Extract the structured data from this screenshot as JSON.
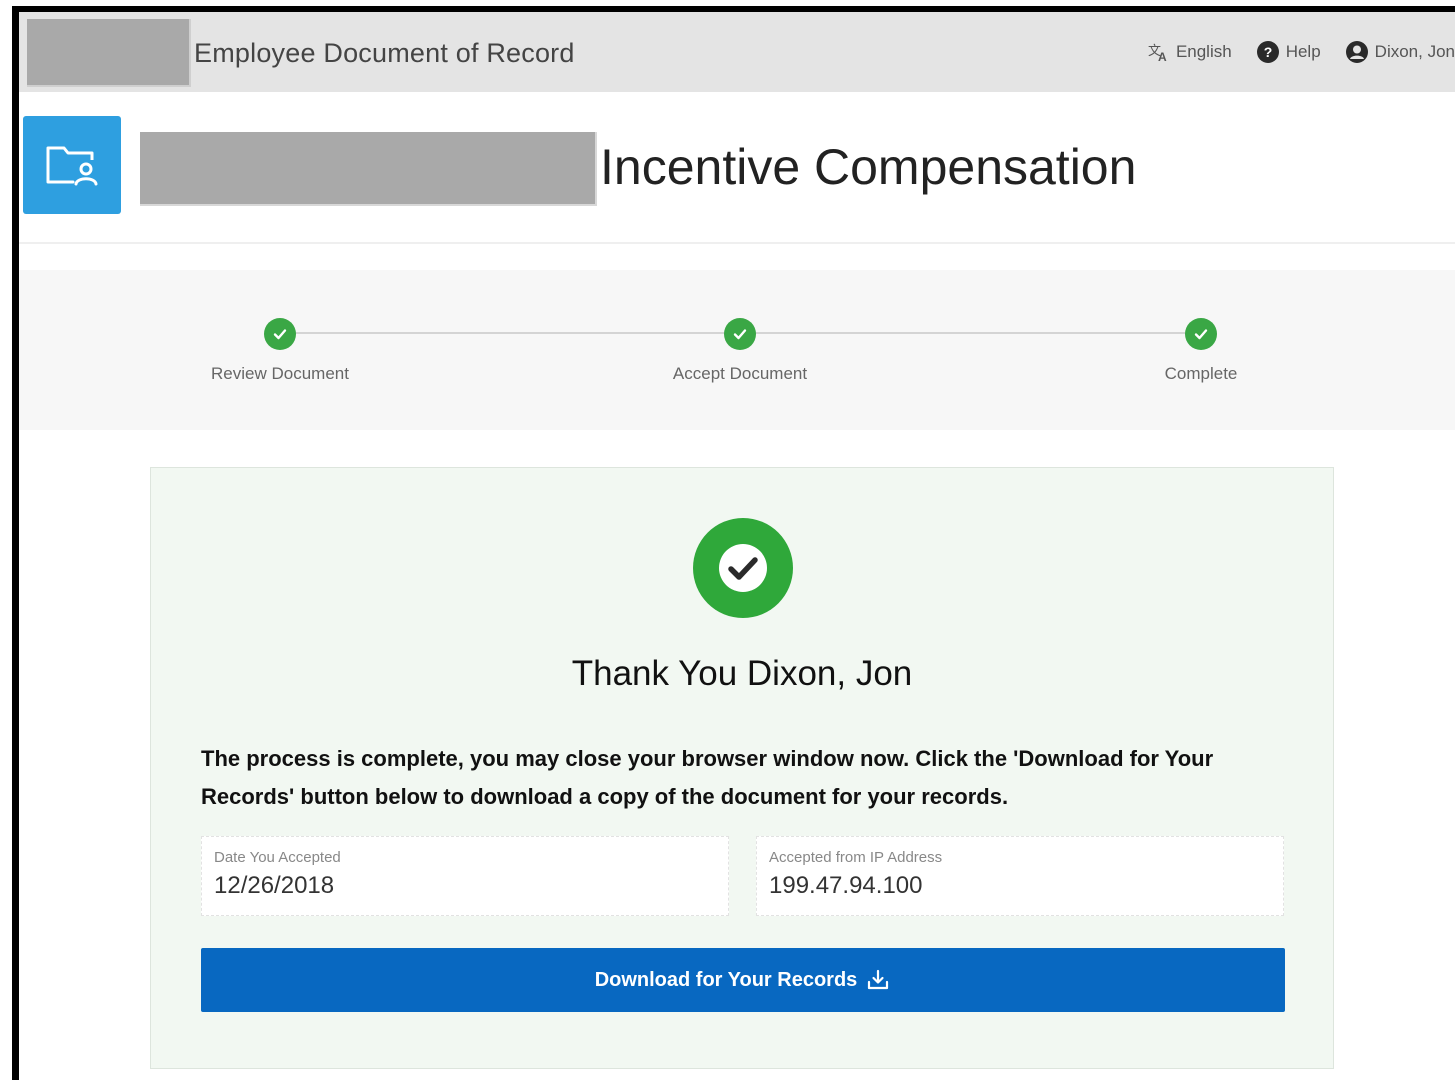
{
  "topbar": {
    "title": "Employee Document of Record",
    "language_label": "English",
    "help_label": "Help",
    "user_label": "Dixon, Jon"
  },
  "header": {
    "title": "Incentive Compensation"
  },
  "stepper": {
    "steps": [
      {
        "label": "Review Document",
        "status": "complete"
      },
      {
        "label": "Accept Document",
        "status": "complete"
      },
      {
        "label": "Complete",
        "status": "complete"
      }
    ]
  },
  "confirmation": {
    "heading": "Thank You Dixon, Jon",
    "message": "The process is complete, you may close your browser window now. Click the 'Download for Your Records' button below to download a copy of the document for your records.",
    "date_label": "Date You Accepted",
    "date_value": "12/26/2018",
    "ip_label": "Accepted from IP Address",
    "ip_value": "199.47.94.100",
    "download_label": "Download for Your Records"
  },
  "colors": {
    "accent_blue": "#0868c1",
    "tile_blue": "#2e9fe0",
    "success_green": "#2fa83a",
    "card_bg": "#f2f8f2"
  },
  "icons": {
    "language": "translate-icon",
    "help": "question-circle-icon",
    "user": "user-circle-icon",
    "tile": "folder-user-icon",
    "step": "check-circle-icon",
    "download": "download-icon"
  }
}
